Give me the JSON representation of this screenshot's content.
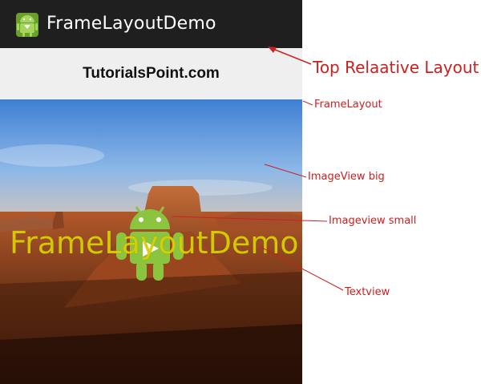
{
  "app": {
    "title": "FrameLayoutDemo",
    "icon": "android-app-icon"
  },
  "header": {
    "text": "TutorialsPoint.com"
  },
  "frame": {
    "overlay_text": "FrameLayoutDemo",
    "big_image": "desert-landscape-image",
    "small_image": "android-robot-icon"
  },
  "annotations": {
    "top_relative_layout": "Top Relaative Layout",
    "frame_layout": "FrameLayout",
    "imageview_big": "ImageView big",
    "imageview_small": "Imageview small",
    "textview": "Textview"
  },
  "colors": {
    "action_bar": "#1f1f1f",
    "header_bg": "#efefef",
    "annotation": "#cc1f1f",
    "overlay_text": "#d8d000",
    "android_green": "#8bc43f"
  }
}
